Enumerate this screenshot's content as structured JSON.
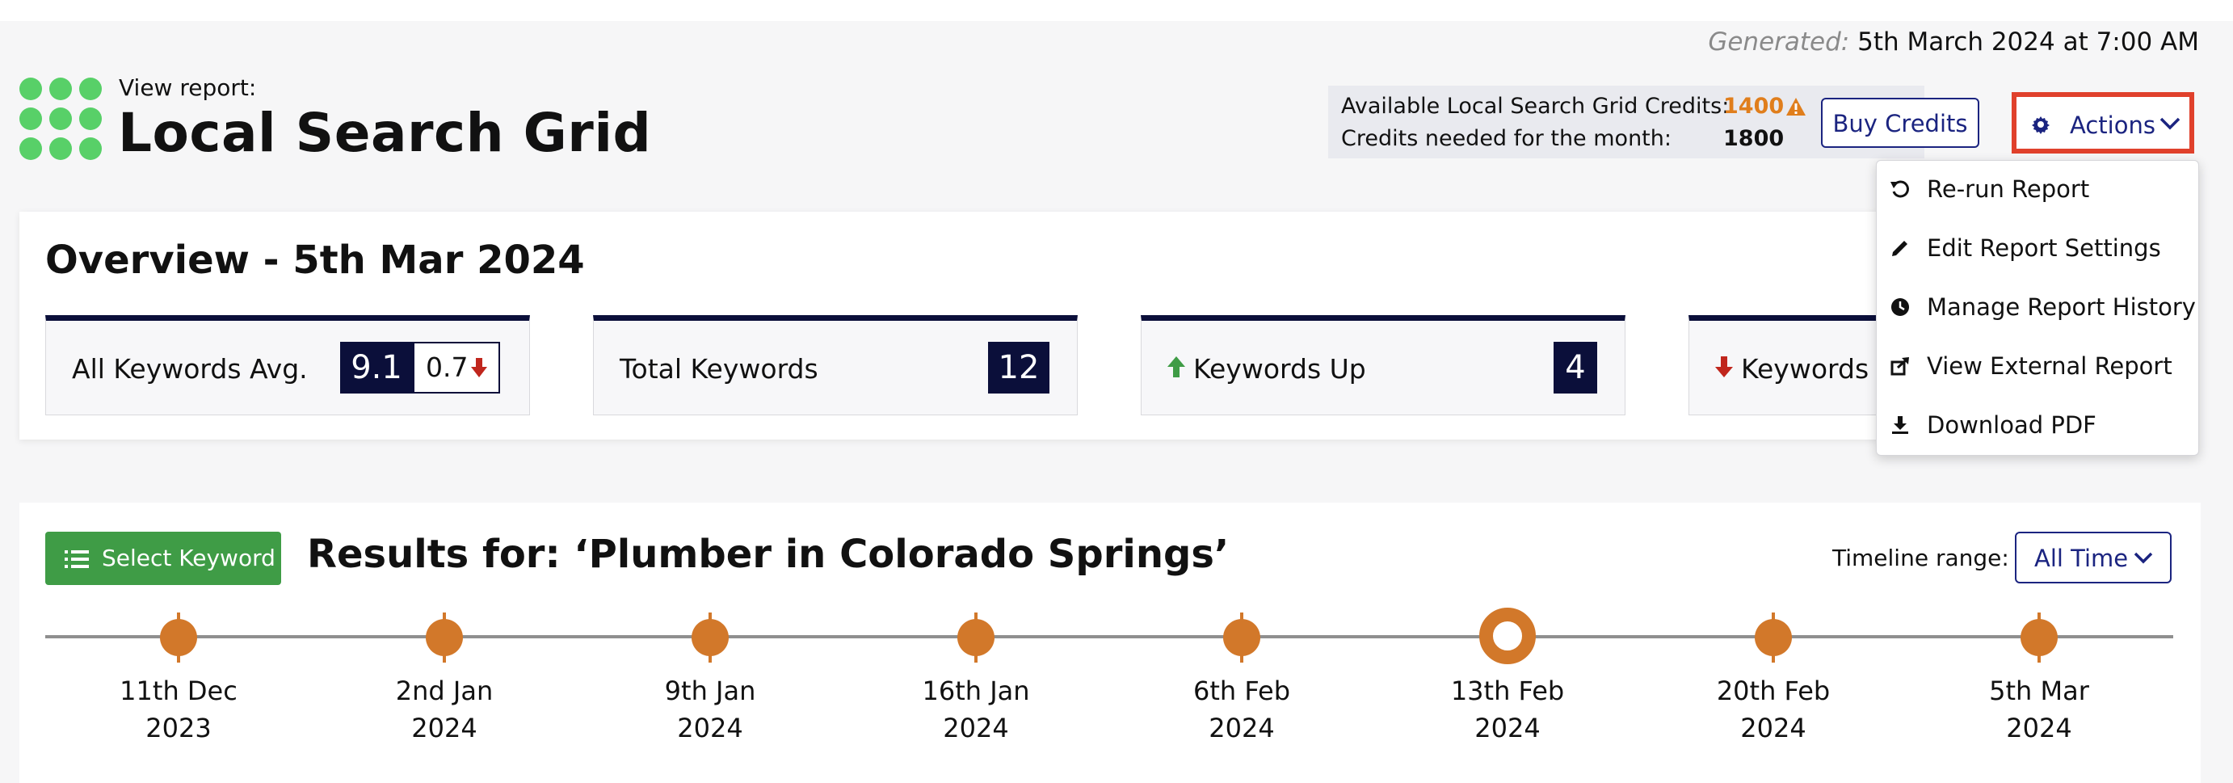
{
  "generated": {
    "label": "Generated:",
    "value": "5th March 2024 at 7:00 AM"
  },
  "header": {
    "view_label": "View report:",
    "title": "Local Search Grid"
  },
  "credits": {
    "available_label": "Available Local Search Grid Credits:",
    "available_value": "1400",
    "needed_label": "Credits needed for the month:",
    "needed_value": "1800",
    "buy_label": "Buy Credits"
  },
  "actions": {
    "label": "Actions",
    "menu": [
      {
        "label": "Re-run Report",
        "icon": "rerun-icon"
      },
      {
        "label": "Edit Report Settings",
        "icon": "pencil-icon"
      },
      {
        "label": "Manage Report History",
        "icon": "clock-icon"
      },
      {
        "label": "View External Report",
        "icon": "external-link-icon"
      },
      {
        "label": "Download PDF",
        "icon": "download-icon"
      }
    ]
  },
  "overview": {
    "title": "Overview - 5th Mar 2024",
    "cards": [
      {
        "label": "All Keywords Avg.",
        "value": "9.1",
        "change": "0.7",
        "change_direction": "down"
      },
      {
        "label": "Total Keywords",
        "value": "12"
      },
      {
        "label": "Keywords Up",
        "value": "4",
        "direction": "up"
      },
      {
        "label": "Keywords D",
        "direction": "down"
      }
    ]
  },
  "results": {
    "select_label": "Select Keyword",
    "title": "Results for: ‘Plumber in Colorado Springs’",
    "timeline_label": "Timeline range:",
    "timeline_value": "All Time",
    "timeline": [
      {
        "line1": "11th Dec",
        "line2": "2023",
        "active": false
      },
      {
        "line1": "2nd Jan",
        "line2": "2024",
        "active": false
      },
      {
        "line1": "9th Jan",
        "line2": "2024",
        "active": false
      },
      {
        "line1": "16th Jan",
        "line2": "2024",
        "active": false
      },
      {
        "line1": "6th Feb",
        "line2": "2024",
        "active": false
      },
      {
        "line1": "13th Feb",
        "line2": "2024",
        "active": true
      },
      {
        "line1": "20th Feb",
        "line2": "2024",
        "active": false
      },
      {
        "line1": "5th Mar",
        "line2": "2024",
        "active": false
      }
    ]
  },
  "colors": {
    "accent": "#1b2480",
    "orange": "#d2782a",
    "green": "#3f9c46",
    "highlight": "#e0412c",
    "navy": "#0b0f3a"
  }
}
